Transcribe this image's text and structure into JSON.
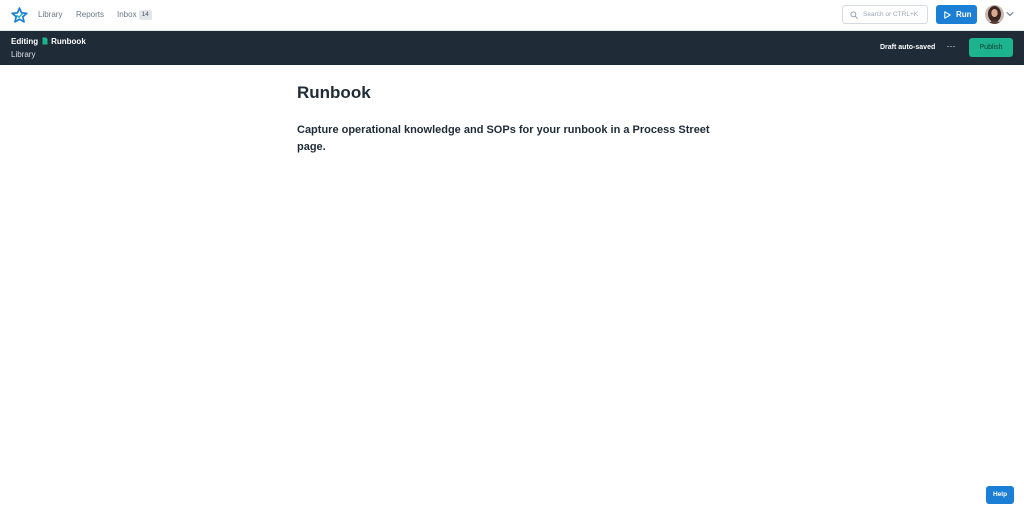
{
  "nav": {
    "logo_icon": "star-logo-icon",
    "library_label": "Library",
    "reports_label": "Reports",
    "inbox_label": "Inbox",
    "inbox_count": "14",
    "search_placeholder": "Search or CTRL+K",
    "run_label": "Run",
    "accent_color": "#1c7fd6"
  },
  "edit_bar": {
    "editing_label": "Editing",
    "page_name": "Runbook",
    "folder_label": "Library",
    "draft_status": "Draft auto-saved",
    "more_label": "···",
    "publish_label": "Publish",
    "background_color": "#1f2b37",
    "publish_color": "#1db38e"
  },
  "content": {
    "title": "Runbook",
    "body": "Capture operational knowledge and SOPs for your runbook in a Process Street page."
  },
  "help": {
    "label": "Help"
  }
}
